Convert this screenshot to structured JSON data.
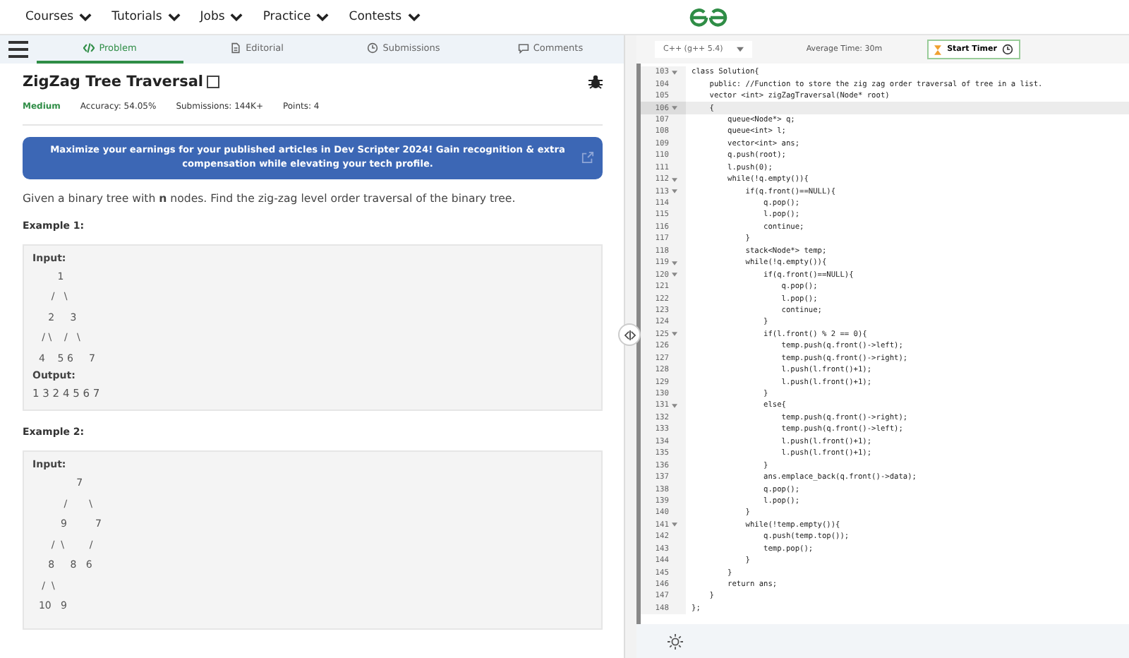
{
  "nav": {
    "items": [
      "Courses",
      "Tutorials",
      "Jobs",
      "Practice",
      "Contests"
    ]
  },
  "tabs": [
    {
      "label": "Problem",
      "selected": true
    },
    {
      "label": "Editorial",
      "selected": false
    },
    {
      "label": "Submissions",
      "selected": false
    },
    {
      "label": "Comments",
      "selected": false
    }
  ],
  "problem": {
    "title": "ZigZag Tree Traversal",
    "difficulty": "Medium",
    "accuracy": "Accuracy: 54.05%",
    "submissions": "Submissions: 144K+",
    "points": "Points: 4",
    "banner": "Maximize your earnings for your published articles in Dev Scripter 2024! Gain recognition & extra compensation while elevating your tech profile.",
    "description": "Given a binary tree with **n** nodes. Find the zig-zag level order traversal of the binary tree.",
    "examples": [
      {
        "heading": "Example 1:",
        "input_label": "Input:",
        "input": "        1\n      /   \\\n     2     3\n   / \\    /   \\\n  4    5 6     7",
        "output_label": "Output:",
        "output": "1 3 2 4 5 6 7"
      },
      {
        "heading": "Example 2:",
        "input_label": "Input:",
        "input": "              7\n          /       \\\n         9         7\n      /  \\        /\n     8     8   6\n   /  \\\n  10   9"
      }
    ]
  },
  "editor": {
    "language": "C++ (g++ 5.4)",
    "average_time": "Average Time: 30m",
    "timer_button": "Start Timer",
    "lines": [
      {
        "number": "103",
        "fold": true,
        "current": false,
        "code": "class Solution{"
      },
      {
        "number": "104",
        "fold": false,
        "current": false,
        "code": "    public: //Function to store the zig zag order traversal of tree in a list."
      },
      {
        "number": "105",
        "fold": false,
        "current": false,
        "code": "    vector <int> zigZagTraversal(Node* root)"
      },
      {
        "number": "106",
        "fold": true,
        "current": true,
        "code": "    {"
      },
      {
        "number": "107",
        "fold": false,
        "current": false,
        "code": "        queue<Node*> q;"
      },
      {
        "number": "108",
        "fold": false,
        "current": false,
        "code": "        queue<int> l;"
      },
      {
        "number": "109",
        "fold": false,
        "current": false,
        "code": "        vector<int> ans;"
      },
      {
        "number": "110",
        "fold": false,
        "current": false,
        "code": "        q.push(root);"
      },
      {
        "number": "111",
        "fold": false,
        "current": false,
        "code": "        l.push(0);"
      },
      {
        "number": "112",
        "fold": true,
        "current": false,
        "code": "        while(!q.empty()){"
      },
      {
        "number": "113",
        "fold": true,
        "current": false,
        "code": "            if(q.front()==NULL){"
      },
      {
        "number": "114",
        "fold": false,
        "current": false,
        "code": "                q.pop();"
      },
      {
        "number": "115",
        "fold": false,
        "current": false,
        "code": "                l.pop();"
      },
      {
        "number": "116",
        "fold": false,
        "current": false,
        "code": "                continue;"
      },
      {
        "number": "117",
        "fold": false,
        "current": false,
        "code": "            }"
      },
      {
        "number": "118",
        "fold": false,
        "current": false,
        "code": "            stack<Node*> temp;"
      },
      {
        "number": "119",
        "fold": true,
        "current": false,
        "code": "            while(!q.empty()){"
      },
      {
        "number": "120",
        "fold": true,
        "current": false,
        "code": "                if(q.front()==NULL){"
      },
      {
        "number": "121",
        "fold": false,
        "current": false,
        "code": "                    q.pop();"
      },
      {
        "number": "122",
        "fold": false,
        "current": false,
        "code": "                    l.pop();"
      },
      {
        "number": "123",
        "fold": false,
        "current": false,
        "code": "                    continue;"
      },
      {
        "number": "124",
        "fold": false,
        "current": false,
        "code": "                }"
      },
      {
        "number": "125",
        "fold": true,
        "current": false,
        "code": "                if(l.front() % 2 == 0){"
      },
      {
        "number": "126",
        "fold": false,
        "current": false,
        "code": "                    temp.push(q.front()->left);"
      },
      {
        "number": "127",
        "fold": false,
        "current": false,
        "code": "                    temp.push(q.front()->right);"
      },
      {
        "number": "128",
        "fold": false,
        "current": false,
        "code": "                    l.push(l.front()+1);"
      },
      {
        "number": "129",
        "fold": false,
        "current": false,
        "code": "                    l.push(l.front()+1);"
      },
      {
        "number": "130",
        "fold": false,
        "current": false,
        "code": "                }"
      },
      {
        "number": "131",
        "fold": true,
        "current": false,
        "code": "                else{"
      },
      {
        "number": "132",
        "fold": false,
        "current": false,
        "code": "                    temp.push(q.front()->right);"
      },
      {
        "number": "133",
        "fold": false,
        "current": false,
        "code": "                    temp.push(q.front()->left);"
      },
      {
        "number": "134",
        "fold": false,
        "current": false,
        "code": "                    l.push(l.front()+1);"
      },
      {
        "number": "135",
        "fold": false,
        "current": false,
        "code": "                    l.push(l.front()+1);"
      },
      {
        "number": "136",
        "fold": false,
        "current": false,
        "code": "                }"
      },
      {
        "number": "137",
        "fold": false,
        "current": false,
        "code": "                ans.emplace_back(q.front()->data);"
      },
      {
        "number": "138",
        "fold": false,
        "current": false,
        "code": "                q.pop();"
      },
      {
        "number": "139",
        "fold": false,
        "current": false,
        "code": "                l.pop();"
      },
      {
        "number": "140",
        "fold": false,
        "current": false,
        "code": "            }"
      },
      {
        "number": "141",
        "fold": true,
        "current": false,
        "code": "            while(!temp.empty()){"
      },
      {
        "number": "142",
        "fold": false,
        "current": false,
        "code": "                q.push(temp.top());"
      },
      {
        "number": "143",
        "fold": false,
        "current": false,
        "code": "                temp.pop();"
      },
      {
        "number": "144",
        "fold": false,
        "current": false,
        "code": "            }"
      },
      {
        "number": "145",
        "fold": false,
        "current": false,
        "code": "        }"
      },
      {
        "number": "146",
        "fold": false,
        "current": false,
        "code": "        return ans;"
      },
      {
        "number": "147",
        "fold": false,
        "current": false,
        "code": "    }"
      },
      {
        "number": "148",
        "fold": false,
        "current": false,
        "code": "};"
      }
    ]
  }
}
